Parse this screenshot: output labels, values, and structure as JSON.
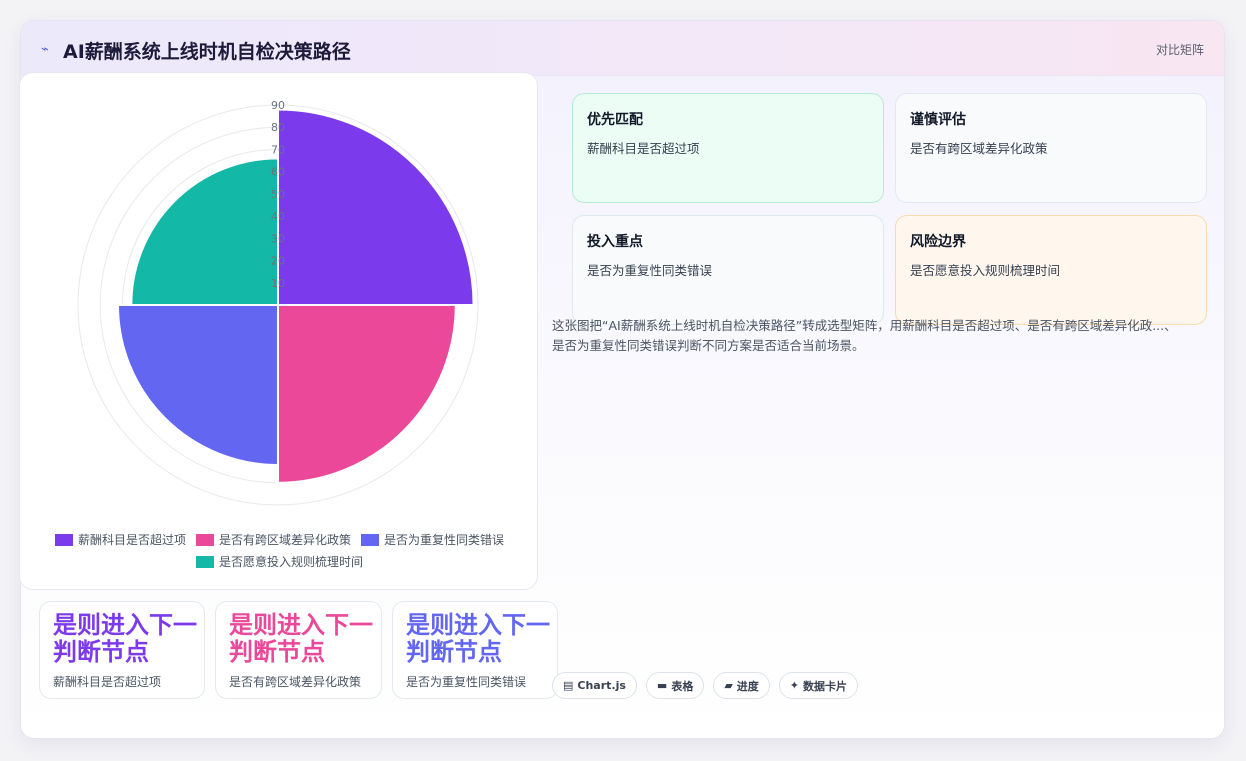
{
  "header": {
    "icon": "trend-arrow-icon",
    "icon_glyph": "⌁",
    "title": "AI薪酬系统上线时机自检决策路径",
    "action": "对比矩阵"
  },
  "chart_data": {
    "type": "polarArea",
    "categories": [
      "薪酬科目是否超过项",
      "是否有跨区域差异化政策",
      "是否为重复性同类错误",
      "是否愿意投入规则梳理时间"
    ],
    "values": [
      88,
      80,
      72,
      66
    ],
    "colors": [
      "#7c3aed",
      "#ec4899",
      "#6366f1",
      "#14b8a6"
    ],
    "r_axis": {
      "min": 0,
      "max": 90,
      "ticks": [
        10,
        20,
        30,
        40,
        50,
        60,
        70,
        80,
        90
      ]
    },
    "legend_position": "bottom",
    "grid": true
  },
  "bottom_cards": [
    {
      "big": "是则进入下一判断节点",
      "small": "薪酬科目是否超过项",
      "color": "#7c3aed"
    },
    {
      "big": "是则进入下一判断节点",
      "small": "是否有跨区域差异化政策",
      "color": "#ec4899"
    },
    {
      "big": "是则进入下一判断节点",
      "small": "是否为重复性同类错误",
      "color": "#6366f1"
    }
  ],
  "matrix": [
    {
      "title": "优先匹配",
      "body": "薪酬科目是否超过项",
      "bg": "#ecfdf5",
      "border": "#b7ecd3"
    },
    {
      "title": "谨慎评估",
      "body": "是否有跨区域差异化政策",
      "bg": "#f8fafc",
      "border": "#e2e8f0"
    },
    {
      "title": "投入重点",
      "body": "是否为重复性同类错误",
      "bg": "#f8fafc",
      "border": "#e2e8f0"
    },
    {
      "title": "风险边界",
      "body": "是否愿意投入规则梳理时间",
      "bg": "#fff7ed",
      "border": "#f8d9b0"
    }
  ],
  "description": "这张图把“AI薪酬系统上线时机自检决策路径”转成选型矩阵，用薪酬科目是否超过项、是否有跨区域差异化政...、是否为重复性同类错误判断不同方案是否适合当前场景。",
  "tags": [
    {
      "icon": "chart-icon",
      "glyph": "▤",
      "label": "Chart.js"
    },
    {
      "icon": "table-icon",
      "glyph": "▬",
      "label": "表格"
    },
    {
      "icon": "progress-icon",
      "glyph": "▰",
      "label": "进度"
    },
    {
      "icon": "data-card-icon",
      "glyph": "✦",
      "label": "数据卡片"
    }
  ]
}
